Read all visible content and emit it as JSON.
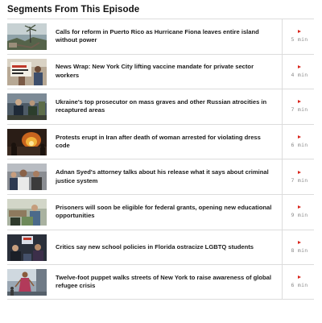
{
  "heading": "Segments From This Episode",
  "segments": [
    {
      "title": "Calls for reform in Puerto Rico as Hurricane Fiona leaves entire island without power",
      "duration": "5 min",
      "thumb_icon": "hurricane-damage-photo"
    },
    {
      "title": "News Wrap: New York City lifting vaccine mandate for private sector workers",
      "duration": "4 min",
      "thumb_icon": "protest-sign-photo"
    },
    {
      "title": "Ukraine's top prosecutor on mass graves and other Russian atrocities in recaptured areas",
      "duration": "7 min",
      "thumb_icon": "ukraine-prosecutor-photo"
    },
    {
      "title": "Protests erupt in Iran after death of woman arrested for violating dress code",
      "duration": "6 min",
      "thumb_icon": "iran-protest-fire-photo"
    },
    {
      "title": "Adnan Syed's attorney talks about his release what it says about criminal justice system",
      "duration": "7 min",
      "thumb_icon": "adnan-syed-crowd-photo"
    },
    {
      "title": "Prisoners will soon be eligible for federal grants, opening new educational opportunities",
      "duration": "9 min",
      "thumb_icon": "prison-classroom-photo"
    },
    {
      "title": "Critics say new school policies in Florida ostracize LGBTQ students",
      "duration": "8 min",
      "thumb_icon": "florida-school-photo"
    },
    {
      "title": "Twelve-foot puppet walks streets of New York to raise awareness of global refugee crisis",
      "duration": "6 min",
      "thumb_icon": "giant-puppet-photo"
    }
  ]
}
